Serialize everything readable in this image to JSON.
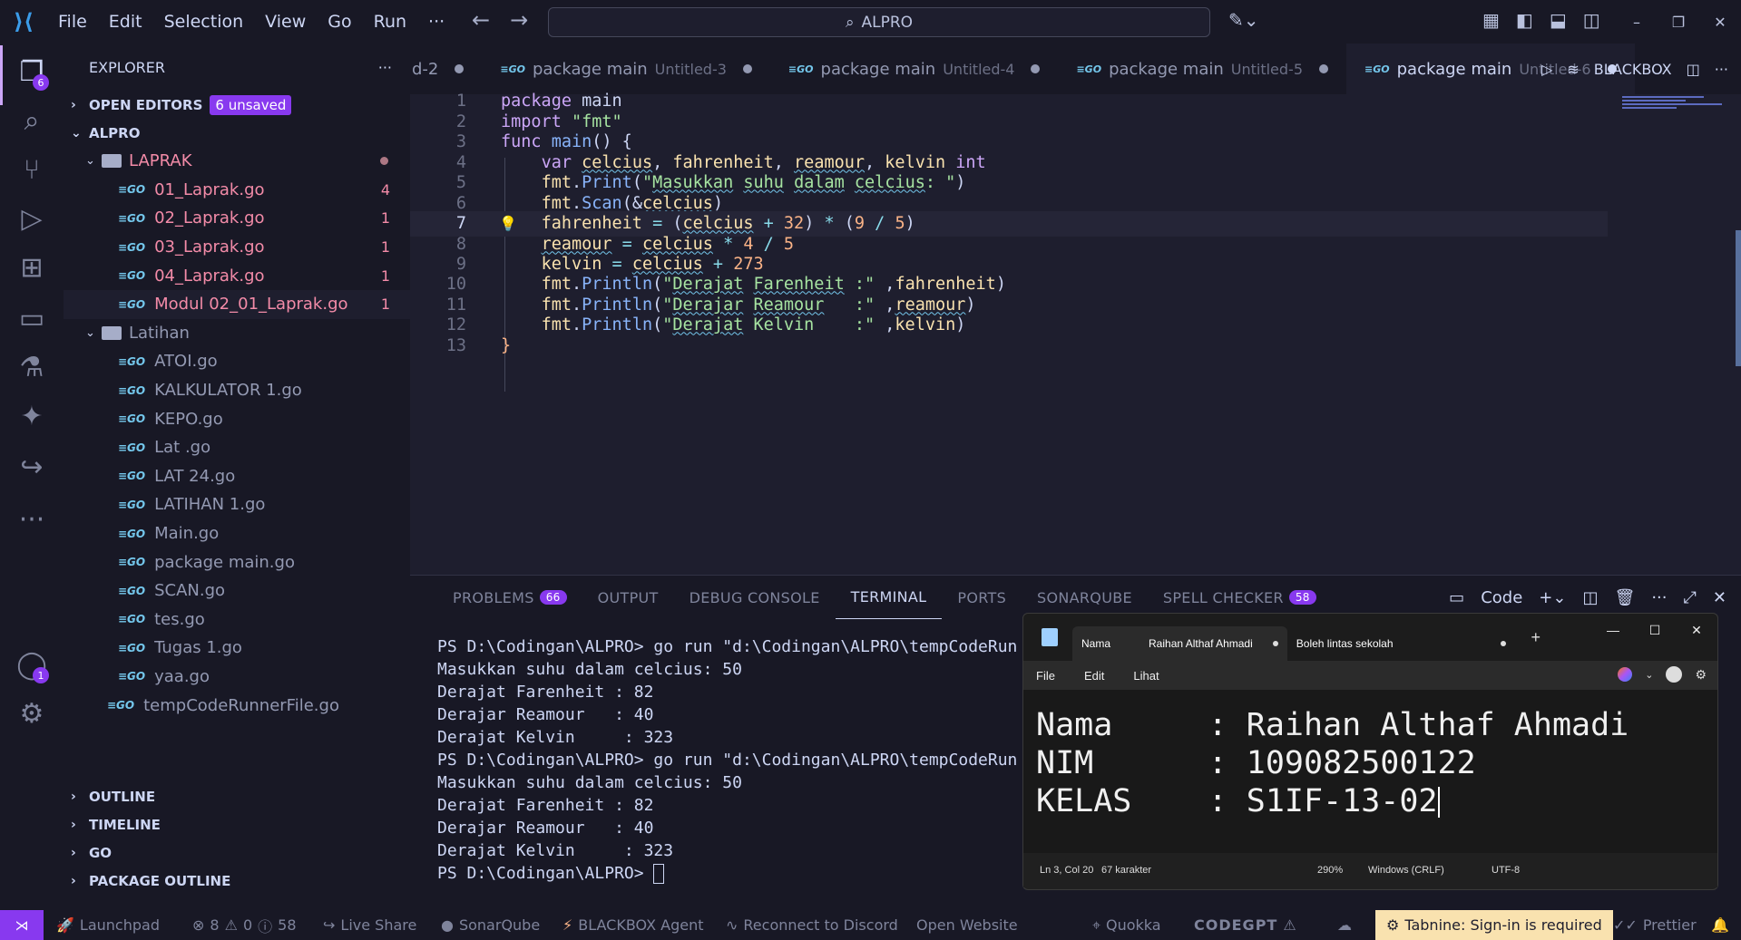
{
  "window": {
    "menu": [
      "File",
      "Edit",
      "Selection",
      "View",
      "Go",
      "Run",
      "···"
    ],
    "search": "ALPRO",
    "controls": [
      "–",
      "❐",
      "✕"
    ]
  },
  "activity": {
    "explorer_badge": "6",
    "accounts_badge": "1"
  },
  "sidebar": {
    "title": "EXPLORER",
    "more": "···",
    "open_editors": "OPEN EDITORS",
    "unsaved": "6 unsaved",
    "root": "ALPRO",
    "laprak_folder": "LAPRAK",
    "laprak_files": [
      {
        "name": "01_Laprak.go",
        "count": "4"
      },
      {
        "name": "02_Laprak.go",
        "count": "1"
      },
      {
        "name": "03_Laprak.go",
        "count": "1"
      },
      {
        "name": "04_Laprak.go",
        "count": "1"
      },
      {
        "name": "Modul 02_01_Laprak.go",
        "count": "1"
      }
    ],
    "latihan_folder": "Latihan",
    "latihan_files": [
      "ATOI.go",
      "KALKULATOR 1.go",
      "KEPO.go",
      "Lat .go",
      "LAT 24.go",
      "LATIHAN 1.go",
      "Main.go",
      "package main.go",
      "SCAN.go",
      "tes.go",
      "Tugas 1.go",
      "yaa.go"
    ],
    "root_file": "tempCodeRunnerFile.go",
    "bottom_sections": [
      "OUTLINE",
      "TIMELINE",
      "GO",
      "PACKAGE OUTLINE"
    ]
  },
  "tabs": [
    {
      "title": "d-2",
      "desc": ""
    },
    {
      "title": "package main",
      "desc": "Untitled-3"
    },
    {
      "title": "package main",
      "desc": "Untitled-4"
    },
    {
      "title": "package main",
      "desc": "Untitled-5"
    },
    {
      "title": "package main",
      "desc": "Untitled-6"
    }
  ],
  "tab_actions": {
    "blackbox": "BLACKBOX"
  },
  "editor": {
    "line_numbers": [
      "1",
      "2",
      "3",
      "4",
      "5",
      "6",
      "7",
      "8",
      "9",
      "10",
      "11",
      "12",
      "13"
    ],
    "current_line": "7"
  },
  "panel": {
    "tabs": [
      {
        "label": "PROBLEMS",
        "badge": "66"
      },
      {
        "label": "OUTPUT",
        "badge": ""
      },
      {
        "label": "DEBUG CONSOLE",
        "badge": ""
      },
      {
        "label": "TERMINAL",
        "badge": ""
      },
      {
        "label": "PORTS",
        "badge": ""
      },
      {
        "label": "SONARQUBE",
        "badge": ""
      },
      {
        "label": "SPELL CHECKER",
        "badge": "58"
      }
    ],
    "terminal_profile": "Code",
    "terminal_lines": [
      "PS D:\\Codingan\\ALPRO> go run \"d:\\Codingan\\ALPRO\\tempCodeRun",
      "Masukkan suhu dalam celcius: 50",
      "Derajat Farenheit : 82",
      "Derajar Reamour   : 40",
      "Derajat Kelvin     : 323",
      "PS D:\\Codingan\\ALPRO> go run \"d:\\Codingan\\ALPRO\\tempCodeRun",
      "Masukkan suhu dalam celcius: 50",
      "Derajat Farenheit : 82",
      "Derajar Reamour   : 40",
      "Derajat Kelvin     : 323"
    ],
    "prompt": "PS D:\\Codingan\\ALPRO> "
  },
  "notepad": {
    "tabs": [
      "Nama",
      "Raihan Althaf Ahmadi",
      "Boleh lintas sekolah"
    ],
    "menu": [
      "File",
      "Edit",
      "Lihat"
    ],
    "lines": [
      "Nama     : Raihan Althaf Ahmadi",
      "NIM      : 109082500122",
      "KELAS    : S1IF-13-02"
    ],
    "status": {
      "position": "Ln 3, Col 20",
      "chars": "67 karakter",
      "zoom": "290%",
      "eol": "Windows (CRLF)",
      "encoding": "UTF-8"
    }
  },
  "statusbar": {
    "launchpad": "Launchpad",
    "errors": "8",
    "warnings": "0",
    "info": "58",
    "live_share": "Live Share",
    "sonarqube": "SonarQube",
    "blackbox": "BLACKBOX Agent",
    "discord": "Reconnect to Discord",
    "website": "Open Website",
    "quokka": "Quokka",
    "codegpt": "CODEGPT",
    "tabnine": "Tabnine: Sign-in is required",
    "prettier": "Prettier"
  }
}
